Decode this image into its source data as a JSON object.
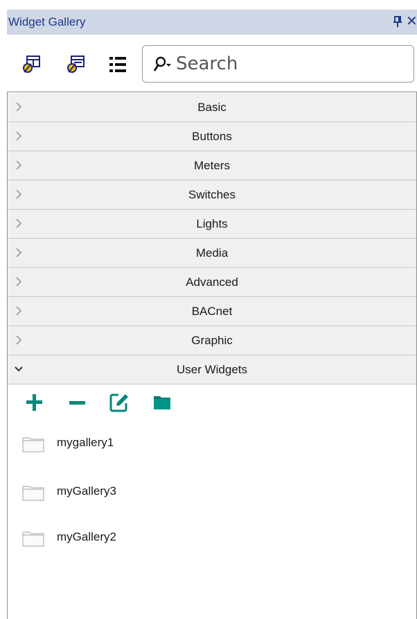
{
  "panel": {
    "title": "Widget Gallery",
    "pin_icon": "pin-icon",
    "close_label": "✕"
  },
  "toolbar": {
    "buttons": [
      {
        "icon": "add-widget-icon"
      },
      {
        "icon": "edit-widget-icon"
      },
      {
        "icon": "list-view-icon"
      }
    ],
    "search": {
      "placeholder": "Search",
      "value": ""
    }
  },
  "categories": [
    {
      "label": "Basic",
      "expanded": false
    },
    {
      "label": "Buttons",
      "expanded": false
    },
    {
      "label": "Meters",
      "expanded": false
    },
    {
      "label": "Switches",
      "expanded": false
    },
    {
      "label": "Lights",
      "expanded": false
    },
    {
      "label": "Media",
      "expanded": false
    },
    {
      "label": "Advanced",
      "expanded": false
    },
    {
      "label": "BACnet",
      "expanded": false
    },
    {
      "label": "Graphic",
      "expanded": false
    },
    {
      "label": "User Widgets",
      "expanded": true
    }
  ],
  "user_widgets": {
    "tools": [
      {
        "icon": "plus-icon"
      },
      {
        "icon": "minus-icon"
      },
      {
        "icon": "edit-icon"
      },
      {
        "icon": "folder-icon"
      }
    ],
    "galleries": [
      {
        "label": "mygallery1"
      },
      {
        "label": "myGallery3"
      },
      {
        "label": "myGallery2"
      }
    ]
  },
  "colors": {
    "title_bar": "#cfd6e5",
    "title_text": "#1e3a8a",
    "category_bg": "#f0f0f0",
    "accent_teal": "#00897b"
  }
}
